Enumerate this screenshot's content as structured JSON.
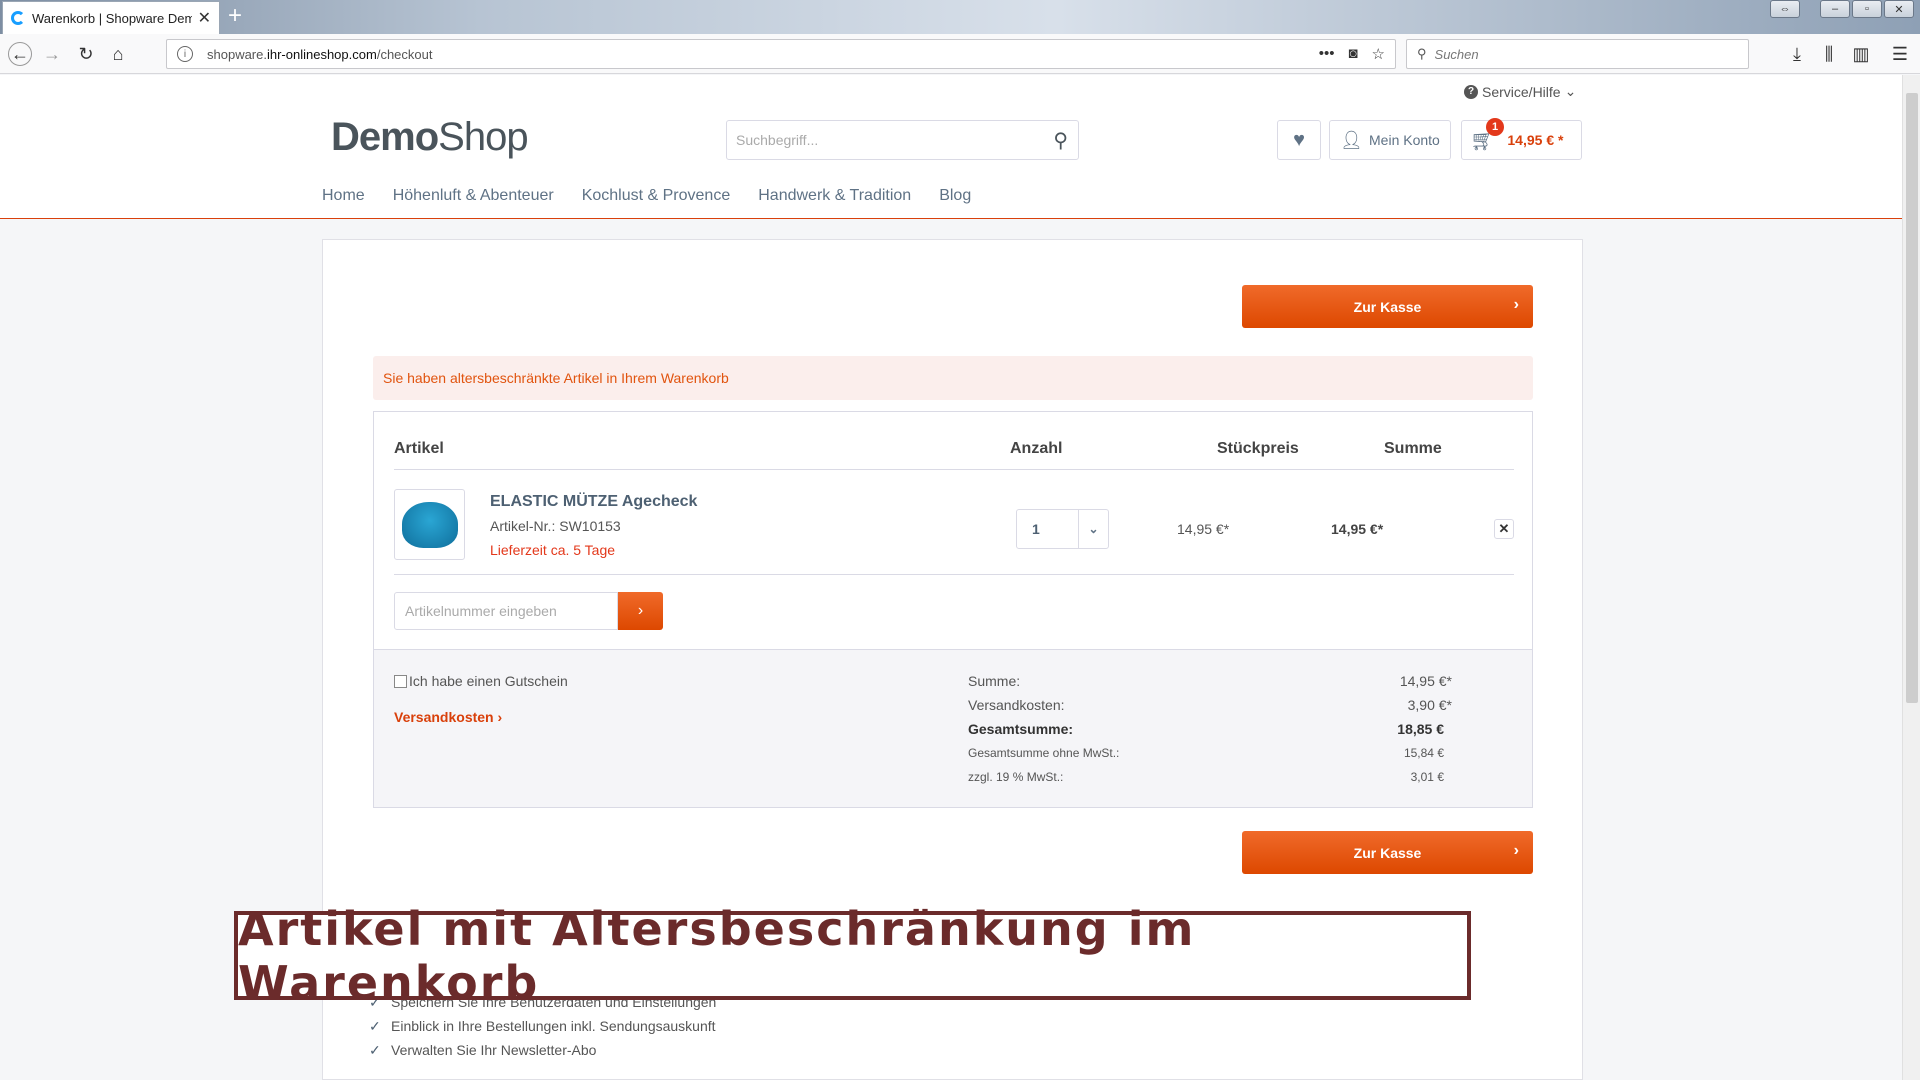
{
  "browser": {
    "tab_title": "Warenkorb | Shopware Demosh",
    "url_prefix": "shopware.",
    "url_host": "ihr-onlineshop.com",
    "url_path": "/checkout",
    "search_placeholder": "Suchen"
  },
  "header": {
    "service_label": "Service/Hilfe",
    "logo_part1": "Demo",
    "logo_part2": "Shop",
    "search_placeholder": "Suchbegriff...",
    "account_label": "Mein Konto",
    "cart_count": "1",
    "cart_total": "14,95 € *"
  },
  "nav": {
    "items": [
      "Home",
      "Höhenluft & Abenteuer",
      "Kochlust & Provence",
      "Handwerk & Tradition",
      "Blog"
    ]
  },
  "checkout": {
    "checkout_button": "Zur Kasse",
    "alert": "Sie haben altersbeschränkte Artikel in Ihrem Warenkorb",
    "columns": {
      "article": "Artikel",
      "quantity": "Anzahl",
      "unit_price": "Stückpreis",
      "total": "Summe"
    },
    "item": {
      "name": "ELASTIC MÜTZE Agecheck",
      "number": "Artikel-Nr.: SW10153",
      "delivery": "Lieferzeit ca. 5 Tage",
      "quantity": "1",
      "unit_price": "14,95 €*",
      "total": "14,95 €*"
    },
    "add_article_placeholder": "Artikelnummer eingeben",
    "voucher_label": "Ich habe einen Gutschein",
    "shipping_link": "Versandkosten",
    "summary": {
      "sum_label": "Summe:",
      "sum_value": "14,95 €*",
      "shipping_label": "Versandkosten:",
      "shipping_value": "3,90 €*",
      "grand_label": "Gesamtsumme:",
      "grand_value": "18,85 €",
      "net_label": "Gesamtsumme ohne MwSt.:",
      "net_value": "15,84 €",
      "vat_label": "zzgl. 19 % MwSt.:",
      "vat_value": "3,01 €"
    }
  },
  "overlay_caption": "Artikel mit Altersbeschränkung im Warenkorb",
  "benefits": [
    "Speichern Sie Ihre Benutzerdaten und Einstellungen",
    "Einblick in Ihre Bestellungen inkl. Sendungsauskunft",
    "Verwalten Sie Ihr Newsletter-Abo"
  ],
  "colors": {
    "accent": "#dd4800",
    "alert_text": "#e1540f",
    "caption": "#6b2b2b"
  }
}
